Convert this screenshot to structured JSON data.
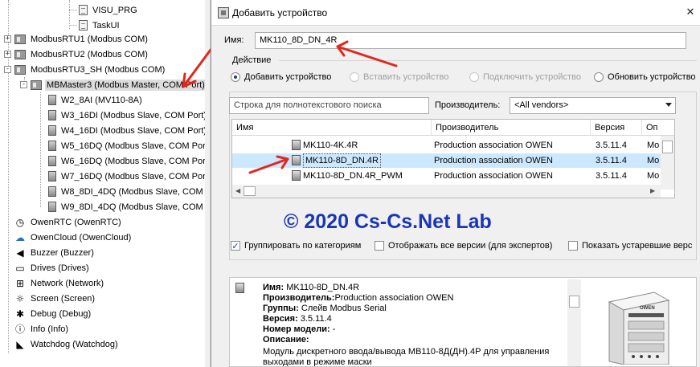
{
  "tree": {
    "nodes": [
      {
        "label": "VISU_PRG",
        "icon": "document-icon"
      },
      {
        "label": "TaskUI",
        "icon": "document-icon"
      },
      {
        "label": "ModbusRTU1 (Modbus COM)",
        "icon": "device-icon",
        "toggle": "+"
      },
      {
        "label": "ModbusRTU2 (Modbus COM)",
        "icon": "device-icon",
        "toggle": "+"
      },
      {
        "label": "ModbusRTU3_SH (Modbus COM)",
        "icon": "device-icon",
        "toggle": "-"
      },
      {
        "label": "MBMaster3 (Modbus Master, COM Port)",
        "icon": "device-icon",
        "toggle": "-"
      },
      {
        "label": "W2_8AI (MV110-8A)",
        "icon": "module-icon"
      },
      {
        "label": "W3_16DI (Modbus Slave, COM Port)",
        "icon": "module-icon"
      },
      {
        "label": "W4_16DI (Modbus Slave, COM Port)",
        "icon": "module-icon"
      },
      {
        "label": "W5_16DQ (Modbus Slave, COM Port",
        "icon": "module-icon"
      },
      {
        "label": "W6_16DQ (Modbus Slave, COM Port",
        "icon": "module-icon"
      },
      {
        "label": "W7_16DQ (Modbus Slave, COM Port",
        "icon": "module-icon"
      },
      {
        "label": "W8_8DI_4DQ (Modbus Slave, COM P",
        "icon": "module-icon"
      },
      {
        "label": "W9_8DI_4DQ (Modbus Slave, COM P",
        "icon": "module-icon"
      },
      {
        "label": "OwenRTC (OwenRTC)",
        "icon": "clock-icon"
      },
      {
        "label": "OwenCloud (OwenCloud)",
        "icon": "cloud-icon"
      },
      {
        "label": "Buzzer (Buzzer)",
        "icon": "speaker-icon"
      },
      {
        "label": "Drives (Drives)",
        "icon": "drive-icon"
      },
      {
        "label": "Network (Network)",
        "icon": "network-icon"
      },
      {
        "label": "Screen (Screen)",
        "icon": "screen-icon"
      },
      {
        "label": "Debug (Debug)",
        "icon": "bug-icon"
      },
      {
        "label": "Info (Info)",
        "icon": "info-icon"
      },
      {
        "label": "Watchdog (Watchdog)",
        "icon": "watchdog-icon"
      }
    ]
  },
  "dialog": {
    "title": "Добавить устройство",
    "close": "✕",
    "name_label": "Имя:",
    "name_value": "MK110_8D_DN_4R",
    "action_label": "Действие",
    "actions": [
      {
        "label": "Добавить устройство",
        "selected": true,
        "enabled": true
      },
      {
        "label": "Вставить устройство",
        "selected": false,
        "enabled": false
      },
      {
        "label": "Подключить устройство",
        "selected": false,
        "enabled": false
      },
      {
        "label": "Обновить устройство",
        "selected": false,
        "enabled": true
      }
    ],
    "search_placeholder": "Строка для полнотекстового поиска",
    "vendor_label": "Производитель:",
    "vendor_value": "<All vendors>",
    "grid": {
      "columns": [
        "Имя",
        "Производитель",
        "Версия",
        "Оп"
      ],
      "rows": [
        {
          "name": "MK110-4K.4R",
          "vendor": "Production association OWEN",
          "version": "3.5.11.4",
          "desc": "Mo",
          "selected": false
        },
        {
          "name": "MK110-8D_DN.4R",
          "vendor": "Production association OWEN",
          "version": "3.5.11.4",
          "desc": "Mo",
          "selected": true
        },
        {
          "name": "MK110-8D_DN.4R_PWM",
          "vendor": "Production association OWEN",
          "version": "3.5.11.4",
          "desc": "Mo",
          "selected": false
        }
      ]
    },
    "watermark": "© 2020 Cs-Cs.Net Lab",
    "options": [
      {
        "label": "Группировать по категориям",
        "checked": true
      },
      {
        "label": "Отображать все версии (для экспертов)",
        "checked": false
      },
      {
        "label": "Показать устаревшие верс",
        "checked": false
      }
    ],
    "info": {
      "name_key": "Имя:",
      "name_val": "MK110-8D_DN.4R",
      "vendor_key": "Производитель:",
      "vendor_val": "Production association OWEN",
      "groups_key": "Группы:",
      "groups_val": "Слейв Modbus Serial",
      "version_key": "Версия:",
      "version_val": "3.5.11.4",
      "model_key": "Номер модели:",
      "model_val": " -",
      "desc_key": "Описание:",
      "desc_val": "Модуль дискретного ввода/вывода МВ110-8Д(ДН).4Р для управления выходами в режиме маски",
      "device_brand": "OWEN"
    }
  },
  "colors": {
    "selection": "#cce8ff",
    "watermark": "#1a35b5",
    "annotation_arrow": "#e0281e"
  }
}
